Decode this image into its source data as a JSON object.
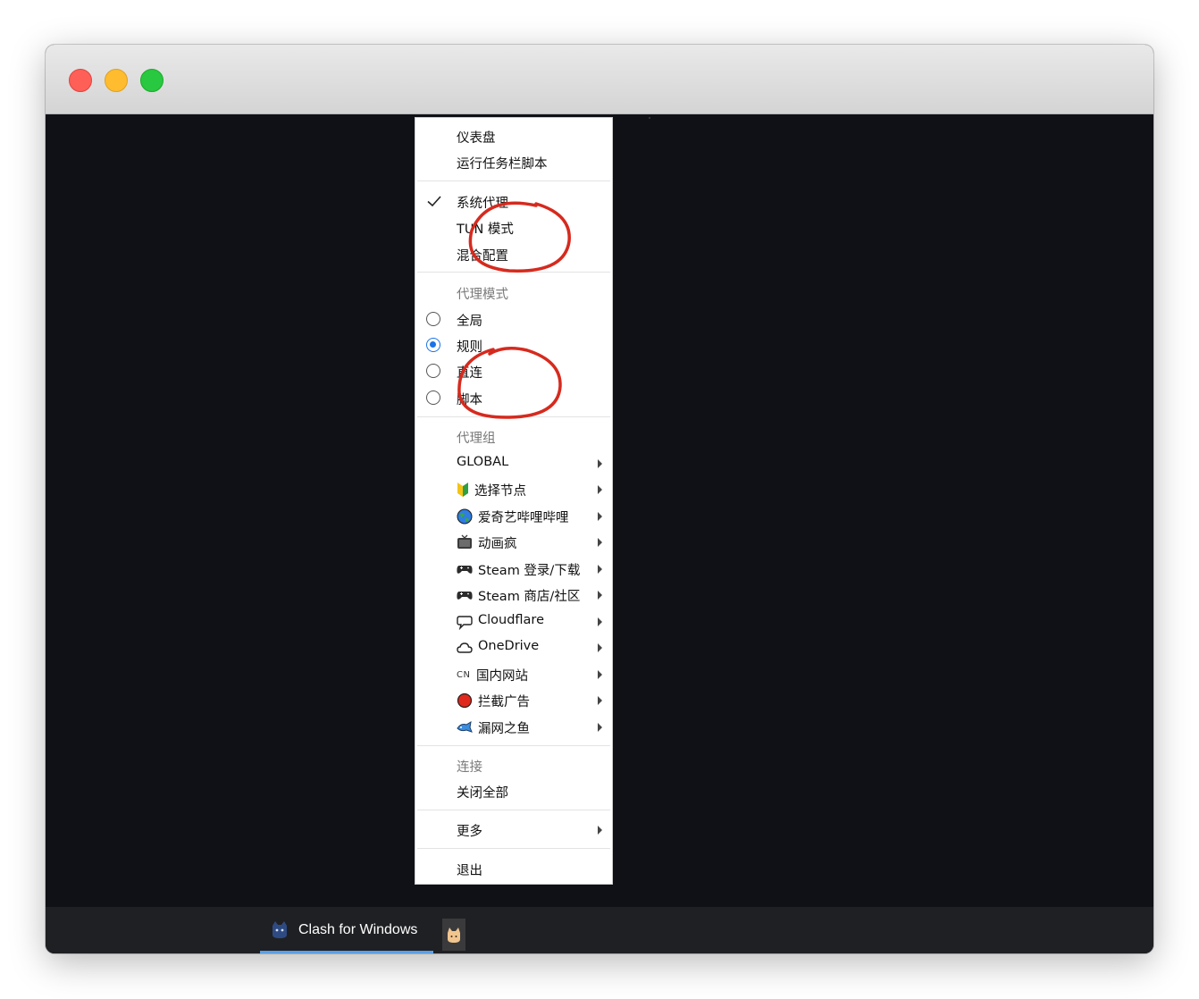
{
  "taskbar": {
    "app_label": "Clash for Windows"
  },
  "menu": {
    "dashboard": "仪表盘",
    "run_script": "运行任务栏脚本",
    "system_proxy": "系统代理",
    "system_proxy_checked": true,
    "tun_mode": "TUN 模式",
    "mixin": "混合配置",
    "proxy_mode_header": "代理模式",
    "mode_global": "全局",
    "mode_rule": "规则",
    "mode_direct": "直连",
    "mode_script": "脚本",
    "selected_mode": "规则",
    "proxy_group_header": "代理组",
    "groups": [
      {
        "label": "GLOBAL",
        "icon": "none"
      },
      {
        "label": "选择节点",
        "icon": "beginner-shield-icon"
      },
      {
        "label": "爱奇艺哔哩哔哩",
        "icon": "globe-icon"
      },
      {
        "label": "动画疯",
        "icon": "tv-icon"
      },
      {
        "label": "Steam 登录/下载",
        "icon": "gamepad-icon"
      },
      {
        "label": "Steam 商店/社区",
        "icon": "gamepad-icon"
      },
      {
        "label": "Cloudflare",
        "icon": "speech-bubble-icon"
      },
      {
        "label": "OneDrive",
        "icon": "cloud-icon"
      },
      {
        "label": "国内网站",
        "icon": "cn-tag"
      },
      {
        "label": "拦截广告",
        "icon": "red-circle-icon"
      },
      {
        "label": "漏网之鱼",
        "icon": "fish-icon"
      }
    ],
    "cn_tag": "CN",
    "connections_header": "连接",
    "close_all": "关闭全部",
    "more": "更多",
    "quit": "退出"
  },
  "colors": {
    "radio_selected": "#1a73e8",
    "annotation_red": "#d62a1e",
    "screen_bg": "#0f1116",
    "taskbar_bg": "#1f2023",
    "active_underline": "#5aa0e6"
  }
}
